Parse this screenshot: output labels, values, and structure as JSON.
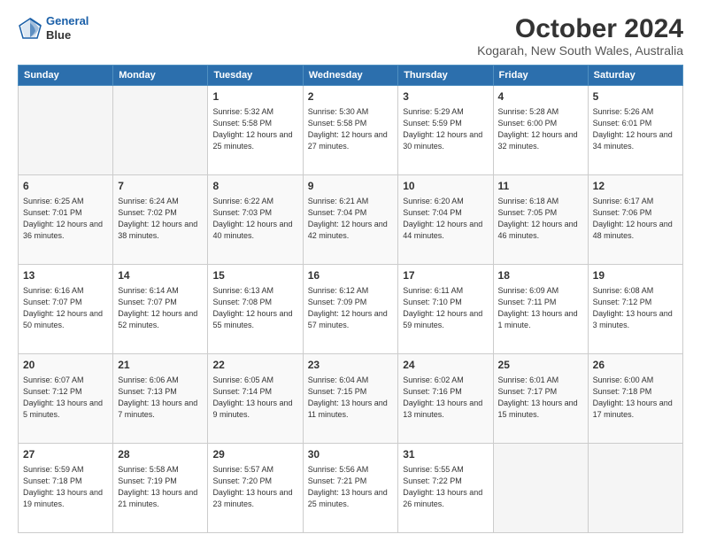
{
  "logo": {
    "line1": "General",
    "line2": "Blue"
  },
  "title": "October 2024",
  "subtitle": "Kogarah, New South Wales, Australia",
  "days_header": [
    "Sunday",
    "Monday",
    "Tuesday",
    "Wednesday",
    "Thursday",
    "Friday",
    "Saturday"
  ],
  "weeks": [
    [
      {
        "day": "",
        "info": ""
      },
      {
        "day": "",
        "info": ""
      },
      {
        "day": "1",
        "info": "Sunrise: 5:32 AM\nSunset: 5:58 PM\nDaylight: 12 hours\nand 25 minutes."
      },
      {
        "day": "2",
        "info": "Sunrise: 5:30 AM\nSunset: 5:58 PM\nDaylight: 12 hours\nand 27 minutes."
      },
      {
        "day": "3",
        "info": "Sunrise: 5:29 AM\nSunset: 5:59 PM\nDaylight: 12 hours\nand 30 minutes."
      },
      {
        "day": "4",
        "info": "Sunrise: 5:28 AM\nSunset: 6:00 PM\nDaylight: 12 hours\nand 32 minutes."
      },
      {
        "day": "5",
        "info": "Sunrise: 5:26 AM\nSunset: 6:01 PM\nDaylight: 12 hours\nand 34 minutes."
      }
    ],
    [
      {
        "day": "6",
        "info": "Sunrise: 6:25 AM\nSunset: 7:01 PM\nDaylight: 12 hours\nand 36 minutes."
      },
      {
        "day": "7",
        "info": "Sunrise: 6:24 AM\nSunset: 7:02 PM\nDaylight: 12 hours\nand 38 minutes."
      },
      {
        "day": "8",
        "info": "Sunrise: 6:22 AM\nSunset: 7:03 PM\nDaylight: 12 hours\nand 40 minutes."
      },
      {
        "day": "9",
        "info": "Sunrise: 6:21 AM\nSunset: 7:04 PM\nDaylight: 12 hours\nand 42 minutes."
      },
      {
        "day": "10",
        "info": "Sunrise: 6:20 AM\nSunset: 7:04 PM\nDaylight: 12 hours\nand 44 minutes."
      },
      {
        "day": "11",
        "info": "Sunrise: 6:18 AM\nSunset: 7:05 PM\nDaylight: 12 hours\nand 46 minutes."
      },
      {
        "day": "12",
        "info": "Sunrise: 6:17 AM\nSunset: 7:06 PM\nDaylight: 12 hours\nand 48 minutes."
      }
    ],
    [
      {
        "day": "13",
        "info": "Sunrise: 6:16 AM\nSunset: 7:07 PM\nDaylight: 12 hours\nand 50 minutes."
      },
      {
        "day": "14",
        "info": "Sunrise: 6:14 AM\nSunset: 7:07 PM\nDaylight: 12 hours\nand 52 minutes."
      },
      {
        "day": "15",
        "info": "Sunrise: 6:13 AM\nSunset: 7:08 PM\nDaylight: 12 hours\nand 55 minutes."
      },
      {
        "day": "16",
        "info": "Sunrise: 6:12 AM\nSunset: 7:09 PM\nDaylight: 12 hours\nand 57 minutes."
      },
      {
        "day": "17",
        "info": "Sunrise: 6:11 AM\nSunset: 7:10 PM\nDaylight: 12 hours\nand 59 minutes."
      },
      {
        "day": "18",
        "info": "Sunrise: 6:09 AM\nSunset: 7:11 PM\nDaylight: 13 hours\nand 1 minute."
      },
      {
        "day": "19",
        "info": "Sunrise: 6:08 AM\nSunset: 7:12 PM\nDaylight: 13 hours\nand 3 minutes."
      }
    ],
    [
      {
        "day": "20",
        "info": "Sunrise: 6:07 AM\nSunset: 7:12 PM\nDaylight: 13 hours\nand 5 minutes."
      },
      {
        "day": "21",
        "info": "Sunrise: 6:06 AM\nSunset: 7:13 PM\nDaylight: 13 hours\nand 7 minutes."
      },
      {
        "day": "22",
        "info": "Sunrise: 6:05 AM\nSunset: 7:14 PM\nDaylight: 13 hours\nand 9 minutes."
      },
      {
        "day": "23",
        "info": "Sunrise: 6:04 AM\nSunset: 7:15 PM\nDaylight: 13 hours\nand 11 minutes."
      },
      {
        "day": "24",
        "info": "Sunrise: 6:02 AM\nSunset: 7:16 PM\nDaylight: 13 hours\nand 13 minutes."
      },
      {
        "day": "25",
        "info": "Sunrise: 6:01 AM\nSunset: 7:17 PM\nDaylight: 13 hours\nand 15 minutes."
      },
      {
        "day": "26",
        "info": "Sunrise: 6:00 AM\nSunset: 7:18 PM\nDaylight: 13 hours\nand 17 minutes."
      }
    ],
    [
      {
        "day": "27",
        "info": "Sunrise: 5:59 AM\nSunset: 7:18 PM\nDaylight: 13 hours\nand 19 minutes."
      },
      {
        "day": "28",
        "info": "Sunrise: 5:58 AM\nSunset: 7:19 PM\nDaylight: 13 hours\nand 21 minutes."
      },
      {
        "day": "29",
        "info": "Sunrise: 5:57 AM\nSunset: 7:20 PM\nDaylight: 13 hours\nand 23 minutes."
      },
      {
        "day": "30",
        "info": "Sunrise: 5:56 AM\nSunset: 7:21 PM\nDaylight: 13 hours\nand 25 minutes."
      },
      {
        "day": "31",
        "info": "Sunrise: 5:55 AM\nSunset: 7:22 PM\nDaylight: 13 hours\nand 26 minutes."
      },
      {
        "day": "",
        "info": ""
      },
      {
        "day": "",
        "info": ""
      }
    ]
  ]
}
